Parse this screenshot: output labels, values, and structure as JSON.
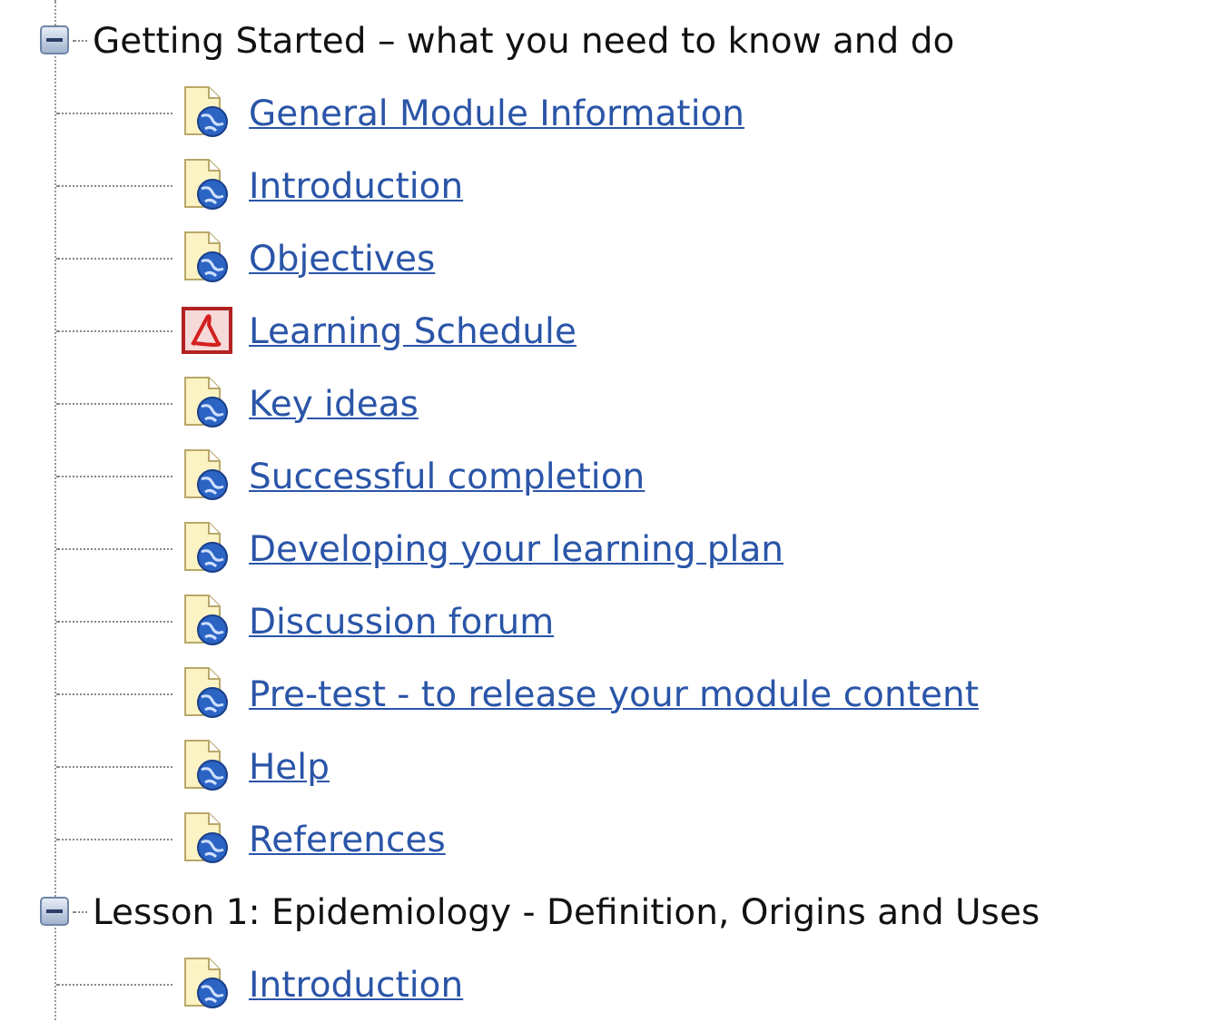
{
  "tree": [
    {
      "label": "Getting Started – what you need to know and do",
      "expanded": true,
      "children": [
        {
          "kind": "web",
          "label": "General Module Information"
        },
        {
          "kind": "web",
          "label": "Introduction"
        },
        {
          "kind": "web",
          "label": "Objectives"
        },
        {
          "kind": "pdf",
          "label": "Learning Schedule"
        },
        {
          "kind": "web",
          "label": "Key ideas"
        },
        {
          "kind": "web",
          "label": "Successful completion"
        },
        {
          "kind": "web",
          "label": "Developing your learning plan"
        },
        {
          "kind": "web",
          "label": "Discussion forum"
        },
        {
          "kind": "web",
          "label": "Pre-test - to release your module content"
        },
        {
          "kind": "web",
          "label": "Help"
        },
        {
          "kind": "web",
          "label": "References"
        }
      ]
    },
    {
      "label": "Lesson 1: Epidemiology - Definition, Origins and Uses",
      "expanded": true,
      "children": [
        {
          "kind": "web",
          "label": "Introduction"
        }
      ]
    }
  ]
}
